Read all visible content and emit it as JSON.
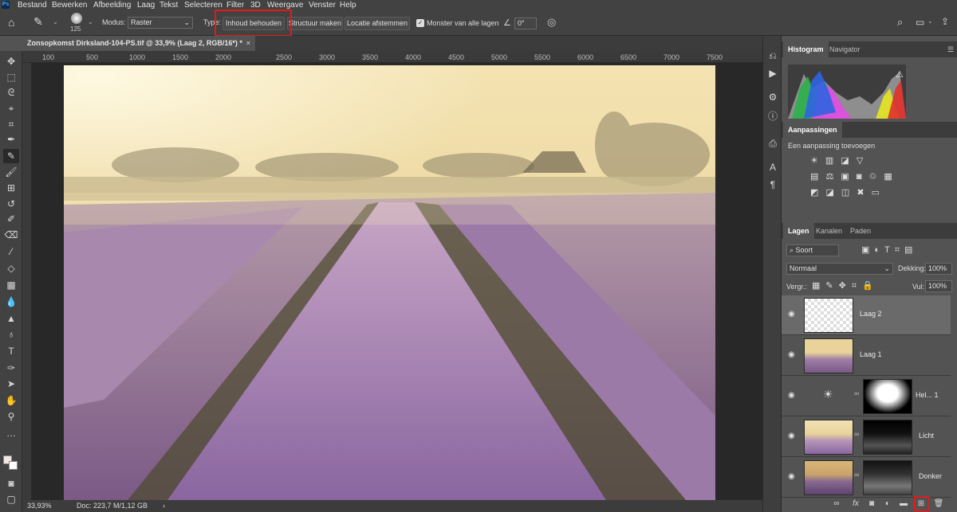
{
  "menu": {
    "items": [
      "Bestand",
      "Bewerken",
      "Afbeelding",
      "Laag",
      "Tekst",
      "Selecteren",
      "Filter",
      "3D",
      "Weergave",
      "Venster",
      "Help"
    ],
    "app_badge": "Ps"
  },
  "options": {
    "brush_size": "125",
    "mode_label": "Modus:",
    "mode_value": "Raster",
    "type_label": "Type:",
    "btn_content": "Inhoud behouden",
    "btn_structure": "Structuur maken",
    "btn_location": "Locatie afstemmen",
    "sample_all": "Monster van alle lagen",
    "angle": "0°"
  },
  "document": {
    "tab_title": "Zonsopkomst Dirksland-104-PS.tif @ 33,9% (Laag 2, RGB/16*) *",
    "tab_close": "×",
    "ruler_marks": [
      "100",
      "500",
      "1000",
      "1500",
      "2000",
      "2500",
      "3000",
      "3500",
      "4000",
      "4500",
      "5000",
      "5500",
      "6000",
      "6500",
      "7000",
      "7500"
    ]
  },
  "status": {
    "zoom": "33,93%",
    "doc": "Doc: 223,7 M/1,12 GB",
    "arrow": "›"
  },
  "panels": {
    "histogram_tab": "Histogram",
    "navigator_tab": "Navigator",
    "adjustments_title": "Aanpassingen",
    "adjustments_hint": "Een aanpassing toevoegen",
    "layers_tab": "Lagen",
    "channels_tab": "Kanalen",
    "paths_tab": "Paden",
    "filter_kind": "Soort",
    "blend_mode": "Normaal",
    "opacity_label": "Dekking:",
    "opacity_value": "100%",
    "lock_label": "Vergr.:",
    "fill_label": "Vul:",
    "fill_value": "100%"
  },
  "layers": [
    {
      "name": "Laag 2"
    },
    {
      "name": "Laag 1"
    },
    {
      "name": "Hel... 1"
    },
    {
      "name": "Licht"
    },
    {
      "name": "Donker"
    }
  ],
  "colors": {
    "highlight": "#e01b1b",
    "panel_bg": "#535353",
    "bar_bg": "#424242"
  }
}
